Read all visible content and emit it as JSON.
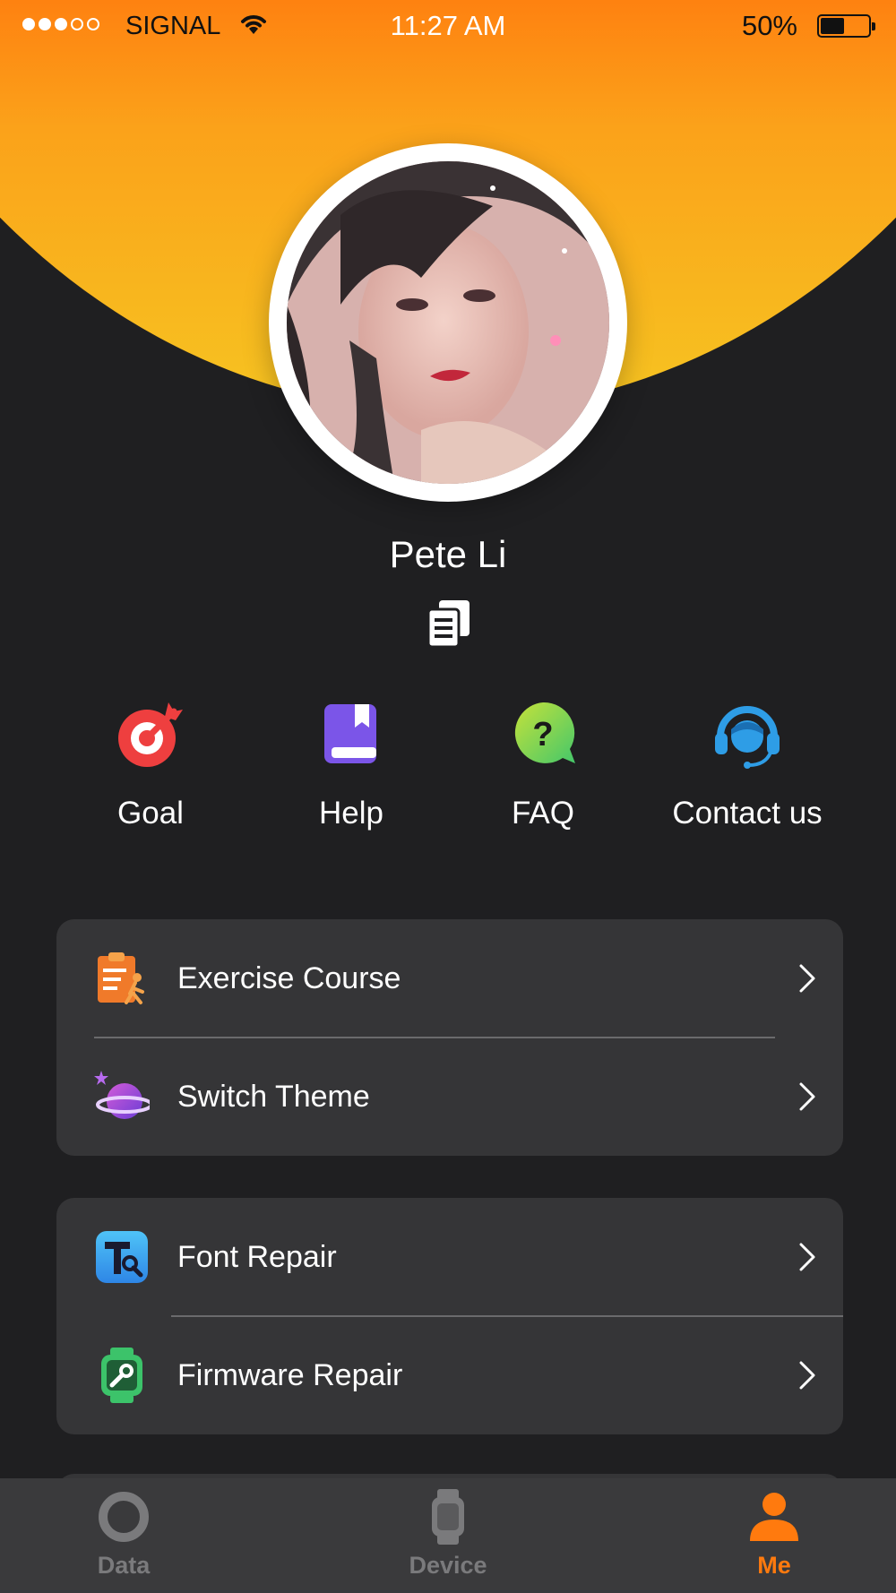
{
  "status_bar": {
    "carrier": "SIGNAL",
    "time": "11:27 AM",
    "battery_percent": "50%",
    "battery_level": 0.5,
    "signal_bars_filled": 3,
    "signal_bars_total": 5
  },
  "profile": {
    "name": "Pete Li",
    "avatar_icon": "user-photo",
    "copy_icon": "copy-icon"
  },
  "quick_actions": [
    {
      "label": "Goal",
      "icon": "target-icon",
      "color": "#ee3f3f"
    },
    {
      "label": "Help",
      "icon": "book-icon",
      "color": "#7b55e8"
    },
    {
      "label": "FAQ",
      "icon": "question-bubble-icon",
      "color": "#a4d82a"
    },
    {
      "label": "Contact us",
      "icon": "headset-icon",
      "color": "#2e9de6"
    }
  ],
  "settings_groups": [
    {
      "items": [
        {
          "label": "Exercise Course",
          "icon": "clipboard-runner-icon"
        },
        {
          "label": "Switch Theme",
          "icon": "planet-icon"
        }
      ]
    },
    {
      "items": [
        {
          "label": "Font Repair",
          "icon": "font-wrench-icon"
        },
        {
          "label": "Firmware Repair",
          "icon": "watch-wrench-icon"
        }
      ]
    }
  ],
  "tab_bar": {
    "tabs": [
      {
        "label": "Data",
        "icon": "ring-icon",
        "active": false
      },
      {
        "label": "Device",
        "icon": "watch-icon",
        "active": false
      },
      {
        "label": "Me",
        "icon": "person-icon",
        "active": true
      }
    ]
  },
  "colors": {
    "accent": "#ff7a0e",
    "accent_yellow": "#f6c421",
    "background": "#1f1f21",
    "card": "#353537",
    "tab_bar": "#3a3a3c",
    "inactive_tab": "#7a7a7c"
  }
}
